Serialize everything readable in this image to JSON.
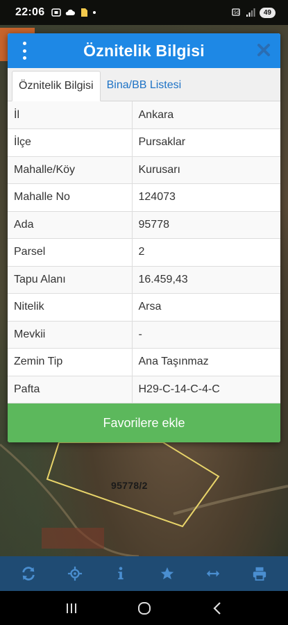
{
  "status_bar": {
    "time": "22:06",
    "battery": "49"
  },
  "map": {
    "parcel_label": "95778/2"
  },
  "dialog": {
    "title": "Öznitelik Bilgisi",
    "tabs": [
      {
        "label": "Öznitelik Bilgisi",
        "active": true
      },
      {
        "label": "Bina/BB Listesi",
        "active": false
      }
    ],
    "rows": [
      {
        "key": "İl",
        "value": "Ankara"
      },
      {
        "key": "İlçe",
        "value": "Pursaklar"
      },
      {
        "key": "Mahalle/Köy",
        "value": "Kurusarı"
      },
      {
        "key": "Mahalle No",
        "value": "124073"
      },
      {
        "key": "Ada",
        "value": "95778"
      },
      {
        "key": "Parsel",
        "value": "2"
      },
      {
        "key": "Tapu Alanı",
        "value": "16.459,43"
      },
      {
        "key": "Nitelik",
        "value": "Arsa"
      },
      {
        "key": "Mevkii",
        "value": "-"
      },
      {
        "key": "Zemin Tip",
        "value": "Ana Taşınmaz"
      },
      {
        "key": "Pafta",
        "value": "H29-C-14-C-4-C"
      }
    ],
    "favorite_button": "Favorilere ekle"
  },
  "toolbar": {
    "icons": [
      "refresh-icon",
      "locate-icon",
      "info-icon",
      "star-icon",
      "measure-icon",
      "print-icon"
    ]
  },
  "colors": {
    "header_blue": "#1e88e5",
    "tab_link": "#1e73c6",
    "fav_green": "#5cb85c",
    "toolbar_blue": "#1f4b73",
    "toolbar_icon": "#4a8ed0"
  }
}
